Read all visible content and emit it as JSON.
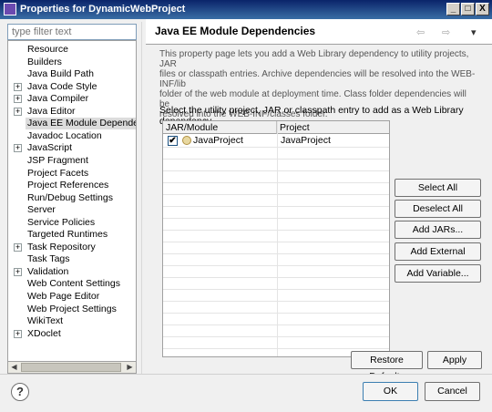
{
  "window": {
    "title": "Properties for DynamicWebProject",
    "minimize": "_",
    "maximize": "□",
    "close": "X"
  },
  "filter": {
    "placeholder": "type filter text"
  },
  "tree": {
    "items": [
      {
        "label": "Resource",
        "expandable": false
      },
      {
        "label": "Builders",
        "expandable": false
      },
      {
        "label": "Java Build Path",
        "expandable": false
      },
      {
        "label": "Java Code Style",
        "expandable": true
      },
      {
        "label": "Java Compiler",
        "expandable": true
      },
      {
        "label": "Java Editor",
        "expandable": true
      },
      {
        "label": "Java EE Module Dependencies",
        "expandable": false,
        "selected": true
      },
      {
        "label": "Javadoc Location",
        "expandable": false
      },
      {
        "label": "JavaScript",
        "expandable": true
      },
      {
        "label": "JSP Fragment",
        "expandable": false
      },
      {
        "label": "Project Facets",
        "expandable": false
      },
      {
        "label": "Project References",
        "expandable": false
      },
      {
        "label": "Run/Debug Settings",
        "expandable": false
      },
      {
        "label": "Server",
        "expandable": false
      },
      {
        "label": "Service Policies",
        "expandable": false
      },
      {
        "label": "Targeted Runtimes",
        "expandable": false
      },
      {
        "label": "Task Repository",
        "expandable": true
      },
      {
        "label": "Task Tags",
        "expandable": false
      },
      {
        "label": "Validation",
        "expandable": true
      },
      {
        "label": "Web Content Settings",
        "expandable": false
      },
      {
        "label": "Web Page Editor",
        "expandable": false
      },
      {
        "label": "Web Project Settings",
        "expandable": false
      },
      {
        "label": "WikiText",
        "expandable": false
      },
      {
        "label": "XDoclet",
        "expandable": true
      }
    ]
  },
  "page": {
    "title": "Java EE Module Dependencies",
    "description_lines": [
      "This property page lets you add a Web Library dependency to utility projects, JAR",
      "files or classpath entries. Archive dependencies will be resolved into the WEB-INF/lib",
      "folder of the web module at deployment time. Class folder dependencies will be",
      "resolved into the WEB-INF/classes folder."
    ],
    "select_label": "Select the utility project, JAR or classpath entry to add as a Web Library dependency",
    "nav": {
      "back": "⇦",
      "forward": "⇨",
      "menu": "▾"
    }
  },
  "table": {
    "headers": [
      "JAR/Module",
      "Project"
    ],
    "rows": [
      {
        "checked": true,
        "module": "JavaProject",
        "project": "JavaProject"
      }
    ]
  },
  "buttons": {
    "select_all": "Select All",
    "deselect_all": "Deselect All",
    "add_jars": "Add JARs...",
    "add_external_jars": "Add External JARs...",
    "add_variable": "Add Variable...",
    "restore_defaults": "Restore Defaults",
    "apply": "Apply",
    "ok": "OK",
    "cancel": "Cancel",
    "help": "?"
  },
  "checkmark": "✔"
}
